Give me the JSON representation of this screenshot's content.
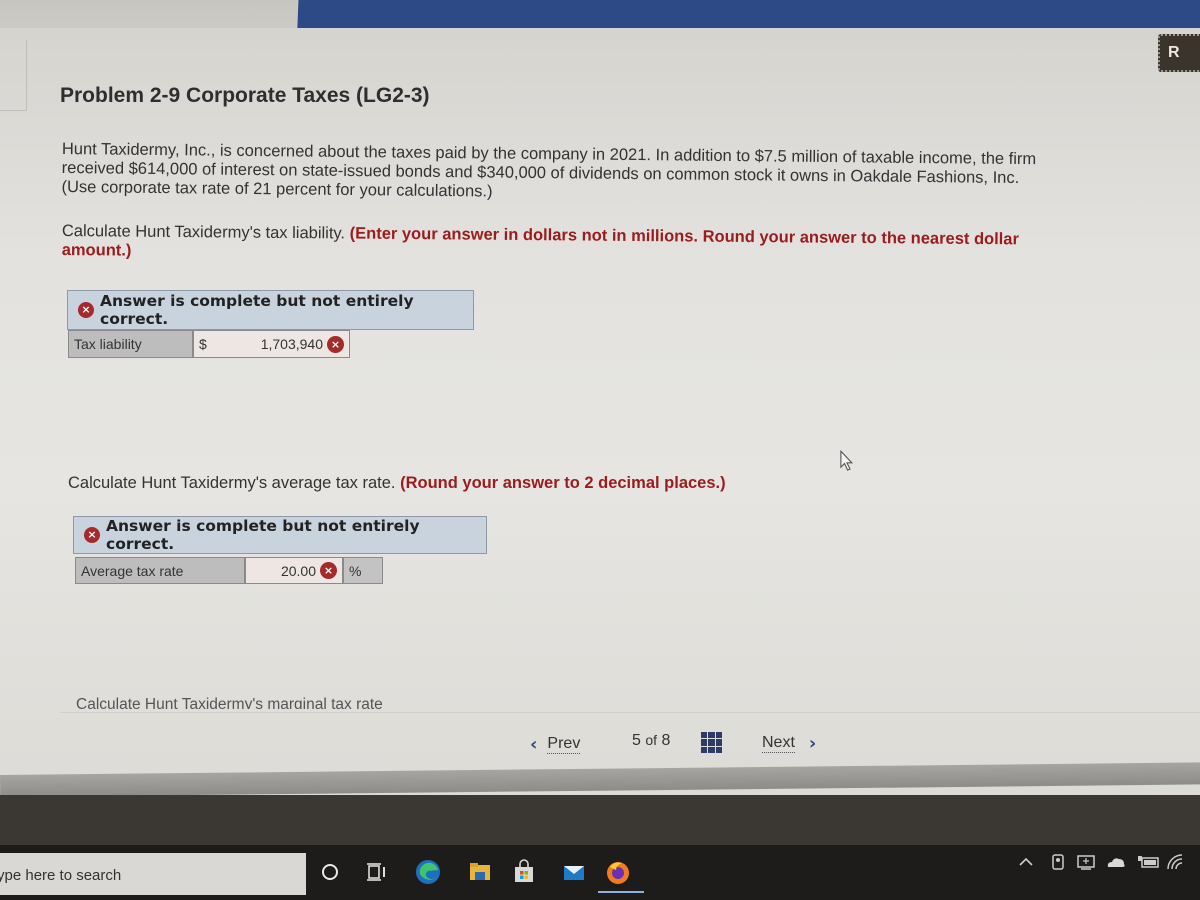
{
  "problem": {
    "title": "Problem 2-9 Corporate Taxes (LG2-3)",
    "paragraph_lines": [
      "Hunt Taxidermy, Inc., is concerned about the taxes paid by the company in 2021. In addition to $7.5 million of taxable income, the firm",
      "received $614,000 of interest on state-issued bonds and $340,000 of dividends on common stock it owns in Oakdale Fashions, Inc.",
      "(Use corporate tax rate of 21 percent for your calculations.)"
    ]
  },
  "questions": [
    {
      "prompt": "Calculate Hunt Taxidermy's tax liability.",
      "hint": "(Enter your answer in dollars not in millions. Round your answer to the nearest dollar amount.)",
      "banner": "Answer is complete but not entirely correct.",
      "field_label": "Tax liability",
      "prefix": "$",
      "value": "1,703,940",
      "status": "incorrect"
    },
    {
      "prompt": "Calculate Hunt Taxidermy's average tax rate.",
      "hint": "(Round your answer to 2 decimal places.)",
      "banner": "Answer is complete but not entirely correct.",
      "field_label": "Average tax rate",
      "value": "20.00",
      "suffix": "%",
      "status": "incorrect"
    },
    {
      "prompt": "Calculate Hunt Taxidermy's marginal tax rate"
    }
  ],
  "navigation": {
    "prev_label": "Prev",
    "next_label": "Next",
    "current_page": "5",
    "of_label": "of",
    "total_pages": "8"
  },
  "corner_badge": "R",
  "icons": {
    "error": "×",
    "prev_chevron": "‹",
    "next_chevron": "›",
    "grid": "grid-icon"
  },
  "taskbar": {
    "search_placeholder": "ype here to search",
    "apps": [
      "cortana-icon",
      "task-view-icon",
      "edge-icon",
      "file-explorer-icon",
      "store-icon",
      "mail-icon",
      "firefox-icon"
    ],
    "tray": [
      "show-hidden-icons",
      "meet-now-icon",
      "screen-icon",
      "onedrive-icon",
      "battery-icon",
      "wifi-icon"
    ]
  },
  "colors": {
    "error": "#a52a2a",
    "hint_text": "#9b1c1c",
    "banner_bg": "#c8d3dd",
    "nav_accent": "#2e4a85"
  }
}
